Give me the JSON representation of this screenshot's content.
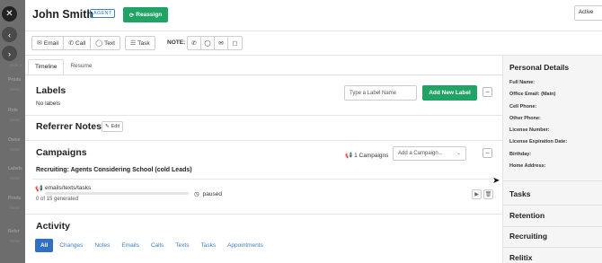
{
  "background": {
    "items": [
      {
        "label": "Produ",
        "sub": "Selec"
      },
      {
        "label": "Role",
        "sub": "Selec"
      },
      {
        "label": "Owne",
        "sub": "Selec"
      },
      {
        "label": "Labels",
        "sub": "Selec"
      },
      {
        "label": "Produ",
        "sub": "Selec"
      },
      {
        "label": "Refer",
        "sub": "Selec"
      }
    ],
    "top_sub": "Hide a"
  },
  "header": {
    "name": "John Smith",
    "badge": "AGENT",
    "reassign_label": "Reassign",
    "status": "Active"
  },
  "toolbar": {
    "email": "Email",
    "call": "Call",
    "text": "Text",
    "task": "Task",
    "note_label": "NOTE:"
  },
  "tabs": [
    "Timeline",
    "Resume"
  ],
  "labels_section": {
    "title": "Labels",
    "empty_text": "No labels",
    "input_placeholder": "Type a Label Name",
    "add_button": "Add New Label"
  },
  "referrer_notes": {
    "title": "Referrer Notes",
    "edit_label": "Edit"
  },
  "campaigns": {
    "title": "Campaigns",
    "count_label": "1 Campaigns",
    "select_placeholder": "Add a Campaign...",
    "campaign_name": "Recruiting: Agents Considering School (cold Leads)",
    "row_name": "emails/texts/tasks",
    "generated": "0 of 15 generated",
    "progress": 0.0,
    "status": "paused"
  },
  "activity": {
    "title": "Activity",
    "tabs": [
      "All",
      "Changes",
      "Notes",
      "Emails",
      "Calls",
      "Texts",
      "Tasks",
      "Appointments"
    ]
  },
  "sidebar": {
    "personal_details_title": "Personal Details",
    "fields": [
      "Full Name:",
      "Office Email: (Main)",
      "Cell Phone:",
      "Other Phone:",
      "License Number:",
      "License Expiration Date:",
      "Birthday:",
      "Home Address:"
    ],
    "sections": [
      "Tasks",
      "Retention",
      "Recruiting",
      "Relitix"
    ]
  },
  "colors": {
    "primary_green": "#21a366",
    "accent_blue": "#2f6fc4"
  }
}
